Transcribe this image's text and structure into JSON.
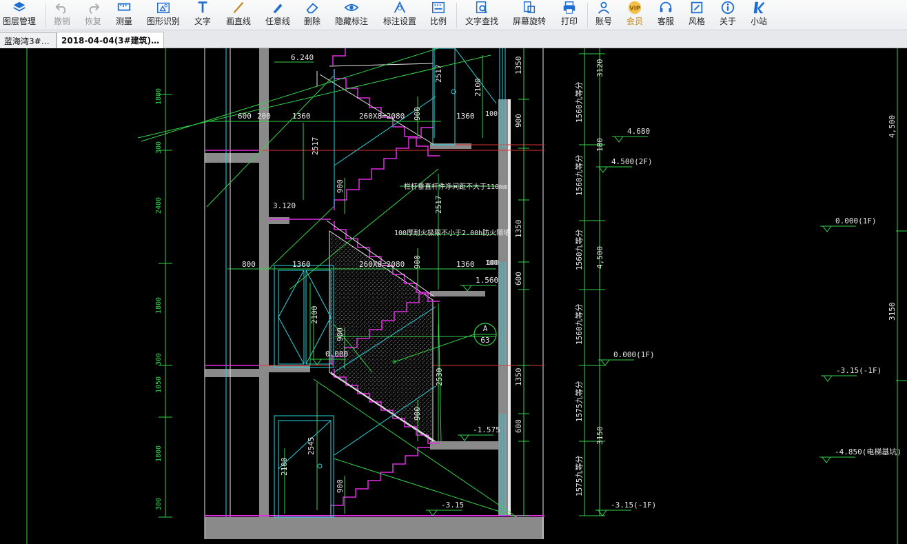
{
  "toolbar": {
    "items": [
      {
        "label": "图层管理",
        "icon": "layers-icon",
        "enabled": true
      },
      {
        "label": "撤销",
        "icon": "undo-icon",
        "enabled": false
      },
      {
        "label": "恢复",
        "icon": "redo-icon",
        "enabled": false
      },
      {
        "label": "测量",
        "icon": "measure-icon",
        "enabled": true
      },
      {
        "label": "图形识别",
        "icon": "shape-recognize-icon",
        "enabled": true
      },
      {
        "label": "文字",
        "icon": "text-icon",
        "enabled": true
      },
      {
        "label": "画直线",
        "icon": "line-icon",
        "enabled": true
      },
      {
        "label": "任意线",
        "icon": "pen-icon",
        "enabled": true
      },
      {
        "label": "删除",
        "icon": "eraser-icon",
        "enabled": true
      },
      {
        "label": "隐藏标注",
        "icon": "eye-icon",
        "enabled": true
      },
      {
        "label": "标注设置",
        "icon": "annotation-settings-icon",
        "enabled": true
      },
      {
        "label": "比例",
        "icon": "scale-icon",
        "enabled": true
      },
      {
        "label": "文字查找",
        "icon": "text-search-icon",
        "enabled": true
      },
      {
        "label": "屏幕旋转",
        "icon": "rotate-screen-icon",
        "enabled": true
      },
      {
        "label": "打印",
        "icon": "printer-icon",
        "enabled": true
      },
      {
        "label": "账号",
        "icon": "user-icon",
        "enabled": true
      },
      {
        "label": "会员",
        "icon": "vip-icon",
        "enabled": true
      },
      {
        "label": "客服",
        "icon": "headset-icon",
        "enabled": true
      },
      {
        "label": "风格",
        "icon": "style-icon",
        "enabled": true
      },
      {
        "label": "关于",
        "icon": "info-icon",
        "enabled": true
      },
      {
        "label": "小站",
        "icon": "k-logo-icon",
        "enabled": true
      }
    ]
  },
  "tabs": [
    {
      "title": "蓝海湾3#…",
      "close": "×",
      "active": false
    },
    {
      "title": "2018-04-04(3#建筑)…",
      "close": "×",
      "active": true
    }
  ],
  "drawing": {
    "left_dims": [
      "1800",
      "300",
      "2400",
      "1800",
      "300",
      "1050",
      "1800",
      "300"
    ],
    "top_dims": [
      "6.240",
      "600",
      "200",
      "1360",
      "260X8=2080",
      "1360",
      "100",
      "3.120",
      "800",
      "1360",
      "260X8=2080",
      "1360",
      "100"
    ],
    "vertical_dims": [
      "2517",
      "2100",
      "900",
      "2517",
      "900",
      "2517",
      "900",
      "2100",
      "900",
      "2530",
      "900",
      "2545",
      "2100",
      "900"
    ],
    "right_dims": [
      "1350",
      "900",
      "1350",
      "600",
      "1350",
      "600",
      "100"
    ],
    "far_right_dims": [
      "3120",
      "180",
      "4,500",
      "3150",
      "4,500",
      "3150"
    ],
    "split_dims": [
      "1560九等分",
      "1560九等分",
      "1560九等分",
      "1560九等分",
      "1575九等分",
      "1575九等分"
    ],
    "elevations": [
      "4.680",
      "4.500(2F)",
      "0.000(1F)",
      "-3.15(-1F)",
      "1.560",
      "0.000",
      "-1.575",
      "-3.15"
    ],
    "far_elevations": [
      "0.000(1F)",
      "-3.15(-1F)",
      "-4.850(电梯基坑)"
    ],
    "notes": [
      "栏杆垂直杆件净间距不大于110mm",
      "100厚耐火极限不小于2.00h防火隔墙"
    ],
    "section_marker": {
      "letter": "A",
      "number": "63"
    }
  }
}
